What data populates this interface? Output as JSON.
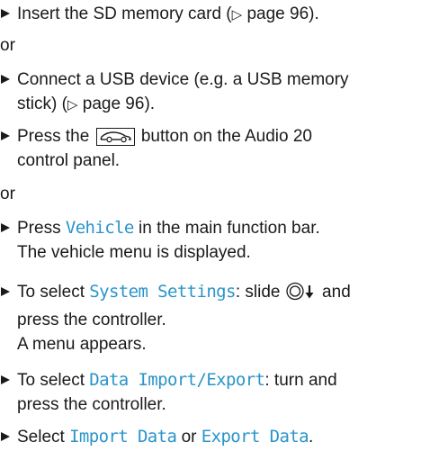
{
  "steps": [
    {
      "pre": "Insert the SD memory card (",
      "ref_arrow": "▷",
      "ref": " page 96)."
    },
    {
      "or": "or"
    },
    {
      "line1": "Connect a USB device (e.g. a USB memory",
      "line2_pre": "stick) (",
      "ref_arrow": "▷",
      "ref": " page 96)."
    },
    {
      "pre": "Press the ",
      "button_icon": "vehicle-button-icon",
      "post": " button on the Audio 20",
      "line2": "control panel."
    },
    {
      "or": "or"
    },
    {
      "pre": "Press ",
      "mono": "Vehicle",
      "post": " in the main function bar.",
      "result": "The vehicle menu is displayed."
    },
    {
      "pre": "To select ",
      "mono": "System Settings",
      "mid": ": slide ",
      "controller_icon": "controller-slide-down-icon",
      "post": " and",
      "line2": "press the controller.",
      "result": "A menu appears."
    },
    {
      "pre": "To select ",
      "mono": "Data Import/Export",
      "post": ": turn and",
      "line2": "press the controller."
    },
    {
      "pre": "Select ",
      "mono1": "Import Data",
      "mid": " or ",
      "mono2": "Export Data",
      "post": "."
    }
  ],
  "colors": {
    "text": "#1a1a1a",
    "accent": "#2a94c9"
  }
}
